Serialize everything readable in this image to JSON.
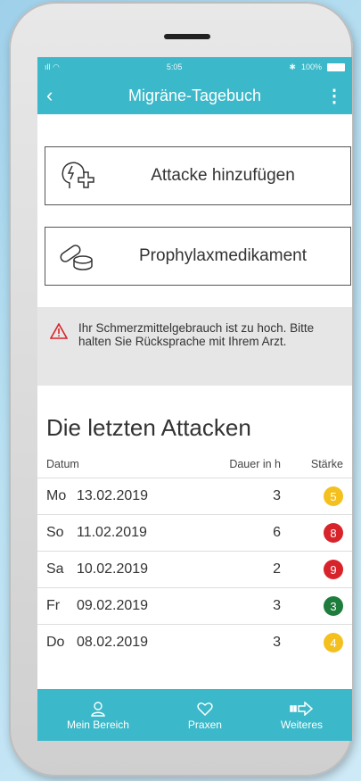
{
  "status_bar": {
    "time": "5:05",
    "battery": "100%"
  },
  "app_bar": {
    "title": "Migräne-Tagebuch",
    "back_icon": "chevron-left-icon",
    "menu_icon": "more-vertical-icon"
  },
  "actions": [
    {
      "label": "Attacke hinzufügen",
      "icon": "head-lightning-plus-icon"
    },
    {
      "label": "Prophylaxmedikament",
      "icon": "pills-icon"
    }
  ],
  "warning": {
    "icon": "warning-triangle-icon",
    "text": "Ihr Schmerzmittelgebrauch ist zu hoch. Bitte halten Sie Rücksprache mit Ihrem Arzt."
  },
  "attacks": {
    "title": "Die letzten Attacken",
    "headers": {
      "date": "Datum",
      "duration": "Dauer in h",
      "strength": "Stärke"
    },
    "rows": [
      {
        "day": "Mo",
        "date": "13.02.2019",
        "duration": "3",
        "strength": "5",
        "color": "#f4c01e"
      },
      {
        "day": "So",
        "date": "11.02.2019",
        "duration": "6",
        "strength": "8",
        "color": "#d8232a"
      },
      {
        "day": "Sa",
        "date": "10.02.2019",
        "duration": "2",
        "strength": "9",
        "color": "#d8232a"
      },
      {
        "day": "Fr",
        "date": "09.02.2019",
        "duration": "3",
        "strength": "3",
        "color": "#1e7d3c"
      },
      {
        "day": "Do",
        "date": "08.02.2019",
        "duration": "3",
        "strength": "4",
        "color": "#f4c01e"
      }
    ]
  },
  "tabs": [
    {
      "label": "Mein Bereich",
      "icon": "person-icon"
    },
    {
      "label": "Praxen",
      "icon": "heart-icon"
    },
    {
      "label": "Weiteres",
      "icon": "arrow-right-icon"
    }
  ],
  "colors": {
    "accent": "#3bb8c9",
    "warning": "#d8232a"
  }
}
